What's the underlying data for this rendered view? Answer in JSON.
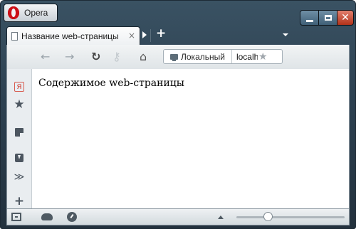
{
  "app": {
    "menu_label": "Opera"
  },
  "tab": {
    "title": "Название web-страницы",
    "close_glyph": "×",
    "new_tab_glyph": "+"
  },
  "toolbar": {
    "back_glyph": "←",
    "forward_glyph": "→",
    "reload_glyph": "↻",
    "key_glyph": "⚷",
    "home_glyph": "⌂",
    "address_badge_label": "Локальный",
    "address_url": "localhost",
    "address_star_glyph": "★"
  },
  "sidebar": {
    "yandex_glyph": "Я",
    "bookmarks_glyph": "★",
    "more_glyph": "≫",
    "add_glyph": "+"
  },
  "window": {
    "close_glyph": "✕"
  },
  "page": {
    "content_text": "Содержимое web-страницы"
  },
  "status": {
    "zoom_level": 0.25
  },
  "colors": {
    "opera_red": "#cc0f16",
    "frame": "#2c4050",
    "close": "#c8472f"
  }
}
